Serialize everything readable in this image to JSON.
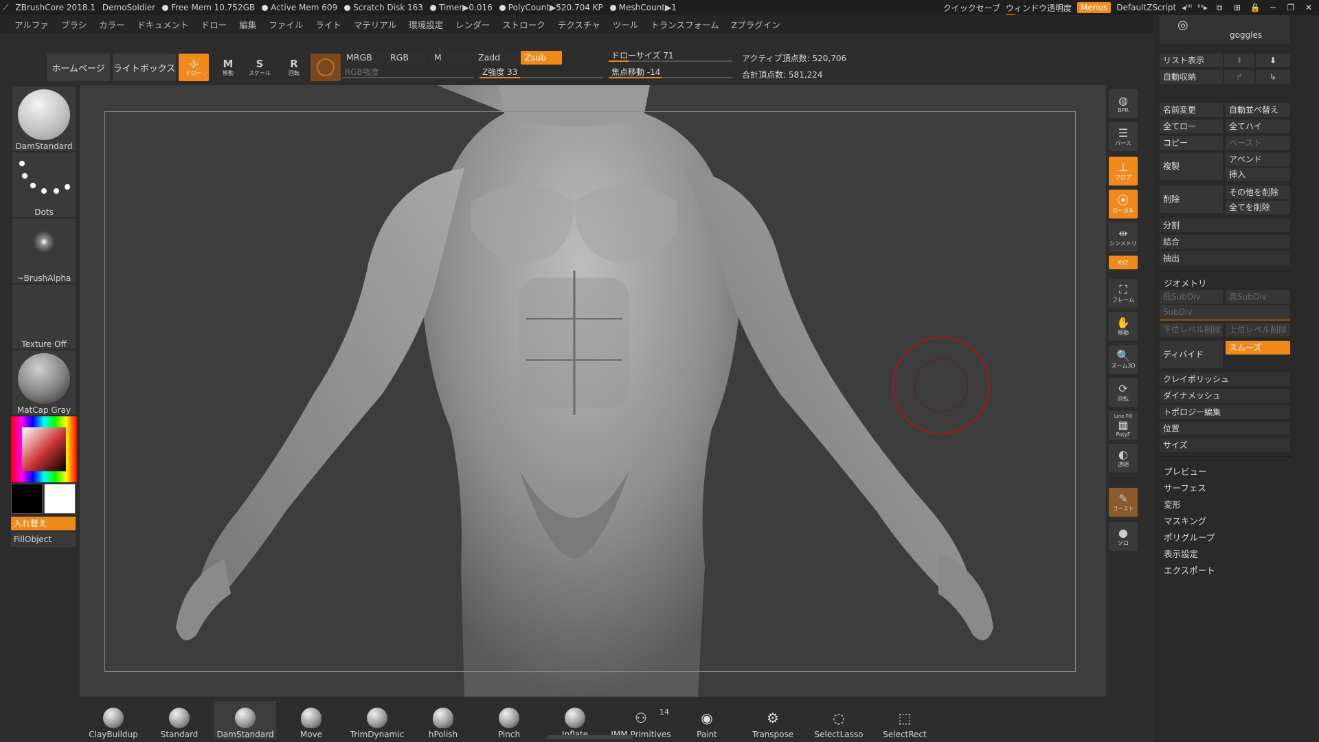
{
  "titlebar": {
    "app": "ZBrushCore 2018.1",
    "user": "DemoSoldier",
    "free_mem": "Free Mem 10.752GB",
    "active_mem": "Active Mem 609",
    "scratch": "Scratch Disk 163",
    "timer": "Timer▶0.016",
    "polycount": "PolyCount▶520.704 KP",
    "meshcount": "MeshCount▶1",
    "quicksave": "クイックセーブ",
    "window_opacity": "ウィンドウ透明度",
    "menus": "Menus",
    "script": "DefaultZScript",
    "arrows_left": "◂ᴵᴵᴵᴵ",
    "arrows_right": "ᴵᴵᴵᴵ▸"
  },
  "menubar": {
    "items": [
      "アルファ",
      "ブラシ",
      "カラー",
      "ドキュメント",
      "ドロー",
      "編集",
      "ファイル",
      "ライト",
      "マテリアル",
      "環境設定",
      "レンダー",
      "ストローク",
      "テクスチャ",
      "ツール",
      "トランスフォーム",
      "Zプラグイン"
    ]
  },
  "shelf": {
    "home": "ホームページ",
    "lightbox": "ライトボックス",
    "draw": "ドロー",
    "move": "移動",
    "scale": "スケール",
    "rotate": "回転",
    "mrgb": "MRGB",
    "rgb": "RGB",
    "m": "M",
    "zadd": "Zadd",
    "zsub": "Zsub",
    "rgb_intensity": "RGB強度",
    "z_intensity": "Z強度 33",
    "draw_size": "ドローサイズ 71",
    "focal_shift": "焦点移動 -14",
    "active_points": "アクティブ頂点数: 520,706",
    "total_points": "合計頂点数: 581,224",
    "z_intensity_pct": 33,
    "draw_size_pct": 16,
    "focal_pct": 43
  },
  "left": {
    "brush": "DamStandard",
    "stroke": "Dots",
    "alpha": "~BrushAlpha",
    "texture": "Texture Off",
    "material": "MatCap Gray",
    "swap": "入れ替え",
    "fill": "FillObject"
  },
  "rtools": {
    "bpr": "BPR",
    "persp": "パース",
    "floor": "フロア",
    "local": "ローカル",
    "symmetry": "シンメトリ",
    "xyz": "XYZ",
    "frame": "フレーム",
    "move": "移動",
    "zoom": "ズーム3D",
    "rotate": "回転",
    "linefill": "Line Fill",
    "polyf": "PolyF",
    "transp": "透明",
    "ghost": "ゴースト",
    "solo": "ソロ"
  },
  "rpanel": {
    "subtool": "goggles",
    "list": "リスト表示",
    "autocollapse": "自動収納",
    "rename": "名前変更",
    "autoreorder": "自動並べ替え",
    "all_low": "全てロー",
    "all_high": "全てハイ",
    "copy": "コピー",
    "paste": "ペースト",
    "duplicate": "複製",
    "append": "アペンド",
    "insert": "挿入",
    "delete": "削除",
    "del_other": "その他を削除",
    "del_all": "全てを削除",
    "split": "分割",
    "merge": "結合",
    "extract": "抽出",
    "geometry": "ジオメトリ",
    "lower_subdiv": "低SubDiv",
    "higher_subdiv": "高SubDiv",
    "subdiv": "SubDiv",
    "del_lower": "下位レベル削除",
    "del_higher": "上位レベル削除",
    "divide": "ディバイド",
    "smooth": "スムーズ",
    "claypolish": "クレイポリッシュ",
    "dynamesh": "ダイナメッシュ",
    "topology": "トポロジー編集",
    "position": "位置",
    "size": "サイズ",
    "sections": [
      "プレビュー",
      "サーフェス",
      "変形",
      "マスキング",
      "ポリグループ",
      "表示設定",
      "エクスポート"
    ]
  },
  "bottom": {
    "brushes": [
      "ClayBuildup",
      "Standard",
      "DamStandard",
      "Move",
      "TrimDynamic",
      "hPolish",
      "Pinch",
      "Inflate",
      "IMM Primitives",
      "Paint",
      "Transpose",
      "SelectLasso",
      "SelectRect"
    ],
    "imm_count": "14"
  }
}
